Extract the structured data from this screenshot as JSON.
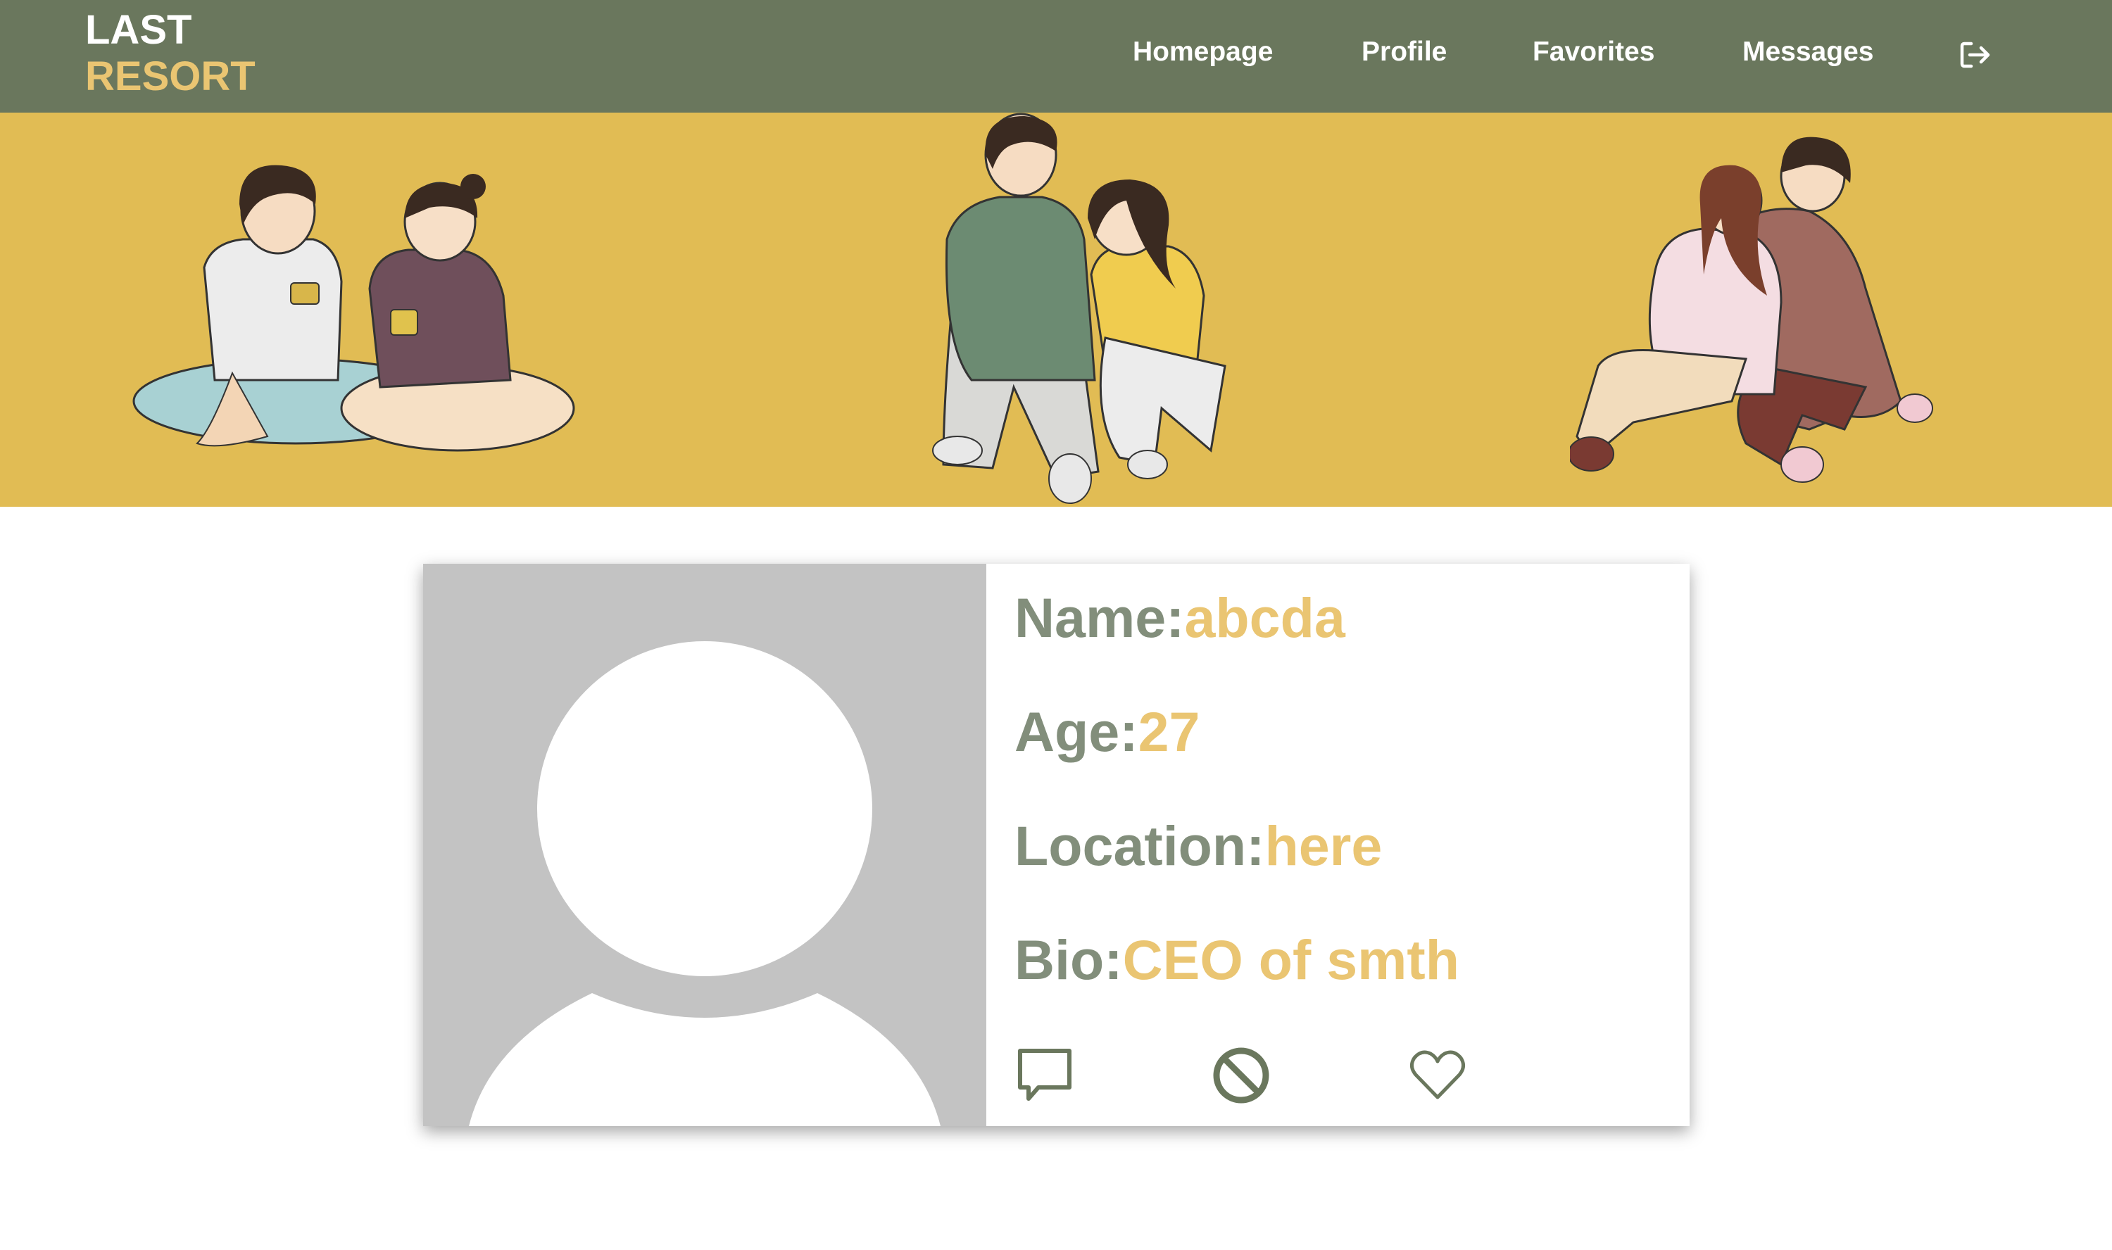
{
  "header": {
    "logo_line1": "LAST",
    "logo_line2": "RESORT",
    "nav": [
      {
        "label": "Homepage"
      },
      {
        "label": "Profile"
      },
      {
        "label": "Favorites"
      },
      {
        "label": "Messages"
      }
    ],
    "logout_icon": "logout-icon"
  },
  "profile": {
    "name_label": "Name:",
    "name_value": "abcda",
    "age_label": "Age:",
    "age_value": "27",
    "location_label": "Location:",
    "location_value": "here",
    "bio_label": "Bio:",
    "bio_value": "CEO of smth",
    "actions": [
      "message-icon",
      "block-icon",
      "heart-icon"
    ]
  },
  "colors": {
    "header_bg": "#6a775d",
    "banner_bg": "#e1bc54",
    "accent": "#eac572",
    "label": "#828e7b",
    "avatar_bg": "#c3c3c3"
  }
}
